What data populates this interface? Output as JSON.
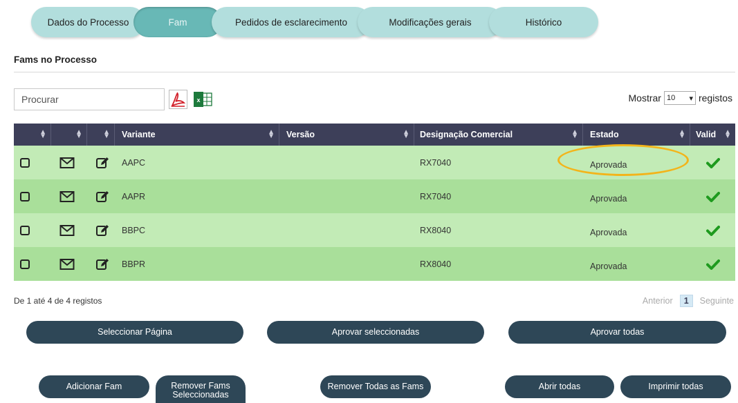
{
  "tabs": [
    {
      "label": "Dados do Processo",
      "active": false
    },
    {
      "label": "Fam",
      "active": true
    },
    {
      "label": "Pedidos de esclarecimento",
      "active": false
    },
    {
      "label": "Modificações gerais",
      "active": false
    },
    {
      "label": "Histórico",
      "active": false
    }
  ],
  "section_title": "Fams no Processo",
  "search": {
    "placeholder": "Procurar",
    "value": ""
  },
  "export_icons": [
    "pdf-icon",
    "excel-icon"
  ],
  "show": {
    "prefix": "Mostrar",
    "value": "10",
    "suffix": "registos"
  },
  "table": {
    "headers": [
      "",
      "",
      "",
      "Variante",
      "Versão",
      "Designação Comercial",
      "Estado",
      "Valid"
    ],
    "rows": [
      {
        "variante": "AAPC",
        "versao": "",
        "designacao": "RX7040",
        "estado": "Aprovada"
      },
      {
        "variante": "AAPR",
        "versao": "",
        "designacao": "RX7040",
        "estado": "Aprovada"
      },
      {
        "variante": "BBPC",
        "versao": "",
        "designacao": "RX8040",
        "estado": "Aprovada"
      },
      {
        "variante": "BBPR",
        "versao": "",
        "designacao": "RX8040",
        "estado": "Aprovada"
      }
    ]
  },
  "info": "De 1 até 4 de 4 registos",
  "pager": {
    "prev": "Anterior",
    "current": "1",
    "next": "Seguinte"
  },
  "buttons": {
    "select_page": "Seleccionar Página",
    "approve_selected": "Aprovar seleccionadas",
    "approve_all": "Aprovar todas",
    "add_fam": "Adicionar Fam",
    "remove_selected": "Remover Fams Seleccionadas",
    "remove_all": "Remover Todas as Fams",
    "open_all": "Abrir todas",
    "print_all": "Imprimir todas"
  },
  "colors": {
    "header": "#3d3f59",
    "row_odd": "#c2ebb6",
    "row_even": "#a9df9a",
    "button": "#2e4757",
    "tab": "#b2dedd",
    "tab_active": "#68b8b6",
    "highlight": "#f3b41a",
    "check": "#1e9a1e"
  }
}
